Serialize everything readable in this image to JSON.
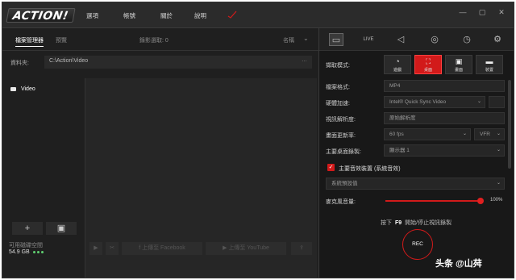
{
  "app": {
    "logo": "ACTION!"
  },
  "menu": [
    {
      "label": "選項"
    },
    {
      "label": "帳號"
    },
    {
      "label": "關於"
    },
    {
      "label": "說明"
    }
  ],
  "window_controls": {
    "minimize": "—",
    "maximize": "▢",
    "close": "✕"
  },
  "left": {
    "tabs": {
      "file_manager": "檔案管理器",
      "preview": "預覽",
      "selected": "錄影選取: 0",
      "sort": "名稱"
    },
    "path": {
      "label": "資料夾:",
      "value": "C:\\Action\\Video"
    },
    "tree": [
      {
        "label": "Video"
      }
    ],
    "buttons": {
      "add": "+",
      "image": "▣"
    },
    "storage": {
      "label": "可用磁碟空間",
      "value": "54.9 GB"
    },
    "bottom_bar": {
      "facebook": "上傳至 Facebook",
      "youtube": "上傳至 YouTube"
    }
  },
  "right": {
    "capture_mode_label": "擷取模式:",
    "modes": [
      {
        "label": "遊戲",
        "icon": "gamepad-icon"
      },
      {
        "label": "桌面",
        "icon": "desktop-icon"
      },
      {
        "label": "畫面",
        "icon": "region-icon"
      },
      {
        "label": "裝置",
        "icon": "device-icon"
      }
    ],
    "settings": [
      {
        "label": "檔案格式:",
        "value": "MP4"
      },
      {
        "label": "硬體加速:",
        "value": "Intel® Quick Sync Video"
      },
      {
        "label": "視訊解析度:",
        "value": "原始解析度"
      },
      {
        "label": "畫面更新率:",
        "value": "60 fps",
        "extra": "VFR"
      },
      {
        "label": "主要桌面錄製:",
        "value": "顯示器 1"
      }
    ],
    "audio_checkbox": "主要音效裝置 (系統音效)",
    "audio_device": "系統預設值",
    "mic_label": "麥克風音量:",
    "mic_volume": "100%",
    "mic_level": 1.0,
    "hotkey": {
      "pre": "按下",
      "key": "F9",
      "post": "開始/停止視訊錄製"
    },
    "rec_label": "REC",
    "accent_color": "#d21a1a"
  },
  "watermark": "头条 @山荈"
}
